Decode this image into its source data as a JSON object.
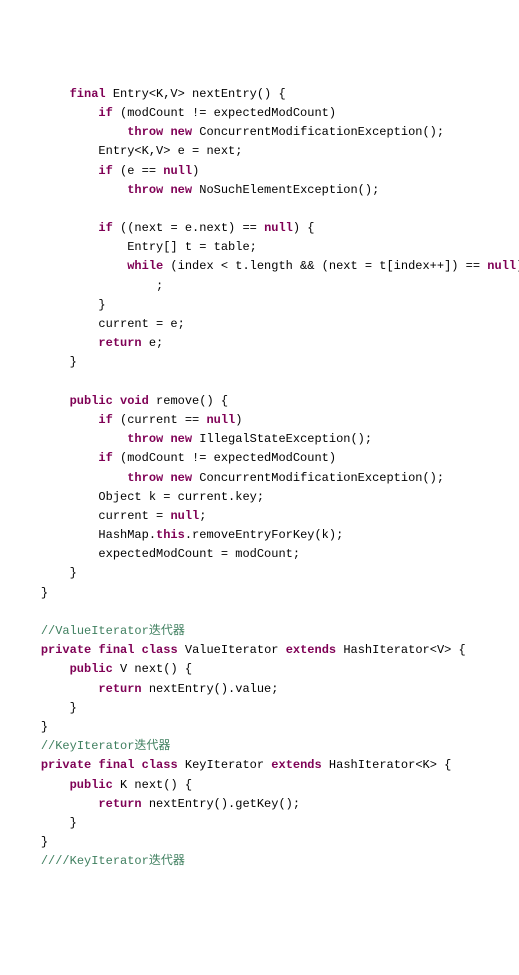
{
  "code": [
    {
      "indent": 2,
      "tokens": [
        {
          "t": "final",
          "c": "k"
        },
        {
          "t": " Entry<K,V> nextEntry() {"
        }
      ]
    },
    {
      "indent": 3,
      "tokens": [
        {
          "t": "if",
          "c": "k"
        },
        {
          "t": " (modCount != expectedModCount)"
        }
      ]
    },
    {
      "indent": 4,
      "tokens": [
        {
          "t": "throw",
          "c": "k"
        },
        {
          "t": " "
        },
        {
          "t": "new",
          "c": "k"
        },
        {
          "t": " ConcurrentModificationException();"
        }
      ]
    },
    {
      "indent": 3,
      "tokens": [
        {
          "t": "Entry<K,V> e = next;"
        }
      ]
    },
    {
      "indent": 3,
      "tokens": [
        {
          "t": "if",
          "c": "k"
        },
        {
          "t": " (e == "
        },
        {
          "t": "null",
          "c": "k"
        },
        {
          "t": ")"
        }
      ]
    },
    {
      "indent": 4,
      "tokens": [
        {
          "t": "throw",
          "c": "k"
        },
        {
          "t": " "
        },
        {
          "t": "new",
          "c": "k"
        },
        {
          "t": " NoSuchElementException();"
        }
      ]
    },
    {
      "indent": 0,
      "tokens": []
    },
    {
      "indent": 3,
      "tokens": [
        {
          "t": "if",
          "c": "k"
        },
        {
          "t": " ((next = e.next) == "
        },
        {
          "t": "null",
          "c": "k"
        },
        {
          "t": ") {"
        }
      ]
    },
    {
      "indent": 4,
      "tokens": [
        {
          "t": "Entry[] t = table;"
        }
      ]
    },
    {
      "indent": 4,
      "tokens": [
        {
          "t": "while",
          "c": "k"
        },
        {
          "t": " (index < t.length && (next = t[index++]) == "
        },
        {
          "t": "null",
          "c": "k"
        },
        {
          "t": ")"
        }
      ]
    },
    {
      "indent": 5,
      "tokens": [
        {
          "t": ";"
        }
      ]
    },
    {
      "indent": 3,
      "tokens": [
        {
          "t": "}"
        }
      ]
    },
    {
      "indent": 3,
      "tokens": [
        {
          "t": "current = e;"
        }
      ]
    },
    {
      "indent": 3,
      "tokens": [
        {
          "t": "return",
          "c": "k"
        },
        {
          "t": " e;"
        }
      ]
    },
    {
      "indent": 2,
      "tokens": [
        {
          "t": "}"
        }
      ]
    },
    {
      "indent": 0,
      "tokens": []
    },
    {
      "indent": 2,
      "tokens": [
        {
          "t": "public",
          "c": "k"
        },
        {
          "t": " "
        },
        {
          "t": "void",
          "c": "k"
        },
        {
          "t": " remove() {"
        }
      ]
    },
    {
      "indent": 3,
      "tokens": [
        {
          "t": "if",
          "c": "k"
        },
        {
          "t": " (current == "
        },
        {
          "t": "null",
          "c": "k"
        },
        {
          "t": ")"
        }
      ]
    },
    {
      "indent": 4,
      "tokens": [
        {
          "t": "throw",
          "c": "k"
        },
        {
          "t": " "
        },
        {
          "t": "new",
          "c": "k"
        },
        {
          "t": " IllegalStateException();"
        }
      ]
    },
    {
      "indent": 3,
      "tokens": [
        {
          "t": "if",
          "c": "k"
        },
        {
          "t": " (modCount != expectedModCount)"
        }
      ]
    },
    {
      "indent": 4,
      "tokens": [
        {
          "t": "throw",
          "c": "k"
        },
        {
          "t": " "
        },
        {
          "t": "new",
          "c": "k"
        },
        {
          "t": " ConcurrentModificationException();"
        }
      ]
    },
    {
      "indent": 3,
      "tokens": [
        {
          "t": "Object k = current.key;"
        }
      ]
    },
    {
      "indent": 3,
      "tokens": [
        {
          "t": "current = "
        },
        {
          "t": "null",
          "c": "k"
        },
        {
          "t": ";"
        }
      ]
    },
    {
      "indent": 3,
      "tokens": [
        {
          "t": "HashMap."
        },
        {
          "t": "this",
          "c": "k"
        },
        {
          "t": ".removeEntryForKey(k);"
        }
      ]
    },
    {
      "indent": 3,
      "tokens": [
        {
          "t": "expectedModCount = modCount;"
        }
      ]
    },
    {
      "indent": 2,
      "tokens": [
        {
          "t": "}"
        }
      ]
    },
    {
      "indent": 1,
      "tokens": [
        {
          "t": "}"
        }
      ]
    },
    {
      "indent": 0,
      "tokens": []
    },
    {
      "indent": 1,
      "tokens": [
        {
          "t": "//ValueIterator迭代器",
          "c": "c"
        }
      ]
    },
    {
      "indent": 1,
      "tokens": [
        {
          "t": "private",
          "c": "k"
        },
        {
          "t": " "
        },
        {
          "t": "final",
          "c": "k"
        },
        {
          "t": " "
        },
        {
          "t": "class",
          "c": "k"
        },
        {
          "t": " ValueIterator "
        },
        {
          "t": "extends",
          "c": "k"
        },
        {
          "t": " HashIterator<V> {"
        }
      ]
    },
    {
      "indent": 2,
      "tokens": [
        {
          "t": "public",
          "c": "k"
        },
        {
          "t": " V next() {"
        }
      ]
    },
    {
      "indent": 3,
      "tokens": [
        {
          "t": "return",
          "c": "k"
        },
        {
          "t": " nextEntry().value;"
        }
      ]
    },
    {
      "indent": 2,
      "tokens": [
        {
          "t": "}"
        }
      ]
    },
    {
      "indent": 1,
      "tokens": [
        {
          "t": "}"
        }
      ]
    },
    {
      "indent": 1,
      "tokens": [
        {
          "t": "//KeyIterator迭代器",
          "c": "c"
        }
      ]
    },
    {
      "indent": 1,
      "tokens": [
        {
          "t": "private",
          "c": "k"
        },
        {
          "t": " "
        },
        {
          "t": "final",
          "c": "k"
        },
        {
          "t": " "
        },
        {
          "t": "class",
          "c": "k"
        },
        {
          "t": " KeyIterator "
        },
        {
          "t": "extends",
          "c": "k"
        },
        {
          "t": " HashIterator<K> {"
        }
      ]
    },
    {
      "indent": 2,
      "tokens": [
        {
          "t": "public",
          "c": "k"
        },
        {
          "t": " K next() {"
        }
      ]
    },
    {
      "indent": 3,
      "tokens": [
        {
          "t": "return",
          "c": "k"
        },
        {
          "t": " nextEntry().getKey();"
        }
      ]
    },
    {
      "indent": 2,
      "tokens": [
        {
          "t": "}"
        }
      ]
    },
    {
      "indent": 1,
      "tokens": [
        {
          "t": "}"
        }
      ]
    },
    {
      "indent": 1,
      "tokens": [
        {
          "t": "////KeyIterator迭代器",
          "c": "c"
        }
      ]
    }
  ],
  "indentUnit": "    "
}
